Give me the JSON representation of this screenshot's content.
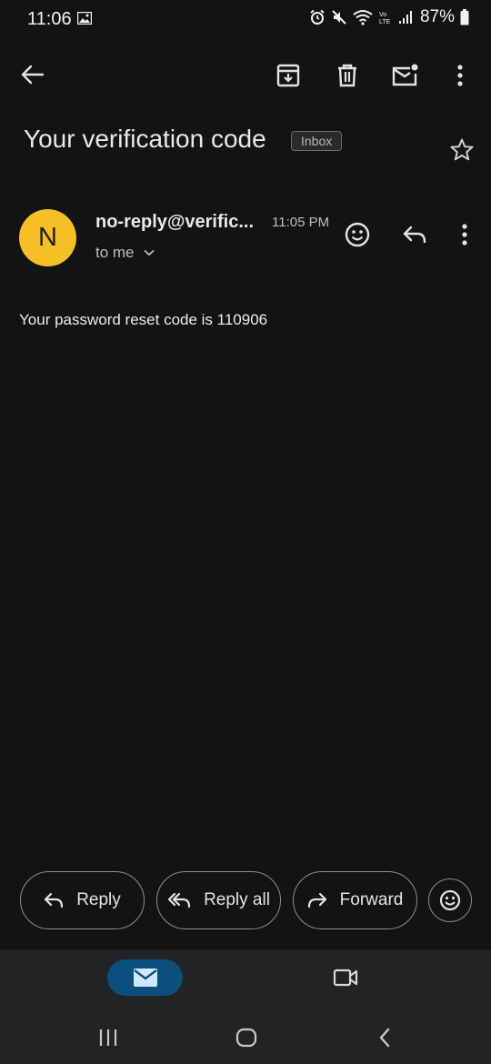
{
  "status_bar": {
    "time": "11:06",
    "battery": "87%",
    "network": "LTE"
  },
  "toolbar": {
    "back_icon": "arrow-left-icon",
    "archive_icon": "archive-icon",
    "delete_icon": "trash-icon",
    "mark_unread_icon": "mark-unread-icon",
    "more_icon": "more-vert-icon"
  },
  "email": {
    "subject": "Your verification code",
    "label": "Inbox",
    "sender": "no-reply@verific...",
    "sender_initial": "N",
    "time": "11:05 PM",
    "recipient": "to me",
    "body": "Your password reset code is 110906"
  },
  "actions": {
    "reply": "Reply",
    "reply_all": "Reply all",
    "forward": "Forward"
  },
  "colors": {
    "background": "#131313",
    "avatar": "#f6bf26",
    "active_tab": "#0b4f7d",
    "nav_bar": "#212325"
  }
}
